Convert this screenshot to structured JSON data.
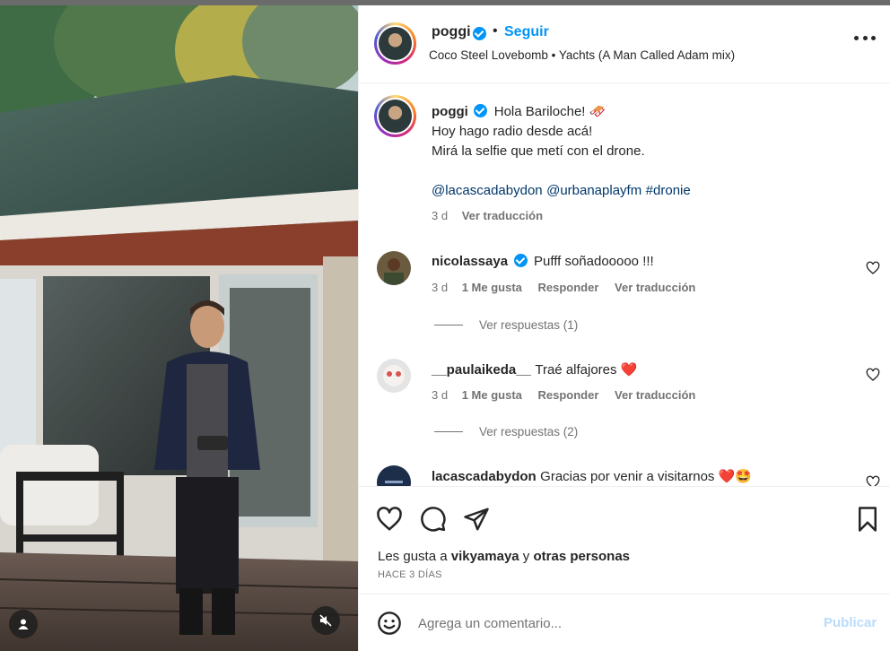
{
  "post": {
    "username": "poggi",
    "follow_label": "Seguir",
    "separator": "•",
    "audio": "Coco Steel Lovebomb • Yachts (A Man Called Adam mix)"
  },
  "caption": {
    "username": "poggi",
    "line1": "Hola Bariloche! 🛷",
    "line2": "Hoy hago radio desde acá!",
    "line3": "Mirá la selfie que metí con el drone.",
    "mention1": "@lacascadabydon",
    "mention2": "@urbanaplayfm",
    "hashtag": "#dronie",
    "time": "3 d",
    "translate_label": "Ver traducción"
  },
  "comments": [
    {
      "username": "nicolassaya",
      "verified": true,
      "text": "Pufff soñadooooo !!!",
      "time": "3 d",
      "likes": "1 Me gusta",
      "reply_label": "Responder",
      "translate_label": "Ver traducción",
      "view_replies": "Ver respuestas (1)"
    },
    {
      "username": "__paulaikeda__",
      "verified": false,
      "text": "Traé alfajores ❤️",
      "time": "3 d",
      "likes": "1 Me gusta",
      "reply_label": "Responder",
      "translate_label": "Ver traducción",
      "view_replies": "Ver respuestas (2)"
    },
    {
      "username": "lacascadabydon",
      "verified": false,
      "text": "Gracias por venir a visitarnos ❤️🤩"
    }
  ],
  "likes_summary": {
    "prefix": "Les gusta a ",
    "user": "vikyamaya",
    "connector": " y ",
    "others": "otras personas"
  },
  "posted_ago": "HACE 3 DÍAS",
  "comment_box": {
    "placeholder": "Agrega un comentario...",
    "publish_label": "Publicar"
  },
  "colors": {
    "accent": "#0095f6",
    "text": "#262626",
    "muted": "#737373",
    "link": "#00376b",
    "publish_disabled": "#b9dcfb",
    "heart_red": "#ed4956"
  },
  "icons": [
    "verified-badge-icon",
    "more-options-icon",
    "heart-icon",
    "comment-icon",
    "share-icon",
    "save-icon",
    "emoji-icon",
    "user-tag-icon",
    "mute-icon"
  ]
}
